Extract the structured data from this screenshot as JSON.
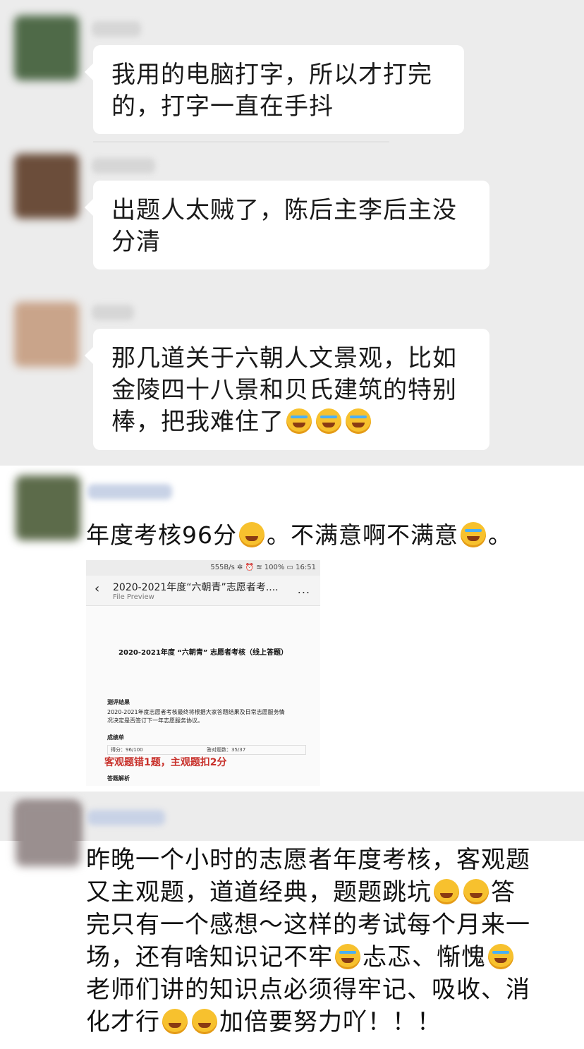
{
  "messages": [
    {
      "text": "我用的电脑打字，所以才打完的，打字一直在手抖"
    },
    {
      "text": "出题人太贼了，陈后主李后主没分清"
    },
    {
      "text_main": "那几道关于六朝人文景观，比如金陵四十八景和贝氏建筑的特别棒，把我难住了"
    }
  ],
  "post1": {
    "part1": "年度考核96分",
    "part2": "。不满意啊不满意",
    "part3": "。"
  },
  "screenshot": {
    "status": "555B/s ✲ ⏰ ≋ 100% ▭ 16:51",
    "title": "2020-2021年度“六朝青”志愿者考....",
    "subtitle": "File Preview",
    "more": "...",
    "doc_title": "2020-2021年度 “六朝青” 志愿者考核（线上答题）",
    "section": "测评结果",
    "body1": "2020-2021年度志愿者考核最终将根据大家答题结果及日常志愿服务情",
    "body2": "况决定是否签订下一年志愿服务协议。",
    "score_header": "成绩单",
    "score": "得分：96/100",
    "answered": "答对题数：35/37",
    "red_note": "客观题错1题，主观题扣2分",
    "analysis": "答题解析"
  },
  "post2": {
    "l1": "昨晚一个小时的志愿者年度考核，客观题",
    "l2a": "又主观题，道道经典，题题跳坑",
    "l2b": "答",
    "l3": "完只有一个感想～这样的考试每个月来一",
    "l4a": "场，还有啥知识记不牢",
    "l4b": "忐忑、惭愧",
    "l5": "老师们讲的知识点必须得牢记、吸收、消",
    "l6a": "化才行",
    "l6b": "加倍要努力吖！！！"
  },
  "icons": [
    "face-palm-emoji",
    "tired-face-emoji",
    "persevere-face-emoji",
    "crying-face-emoji",
    "shushing-face-emoji"
  ]
}
